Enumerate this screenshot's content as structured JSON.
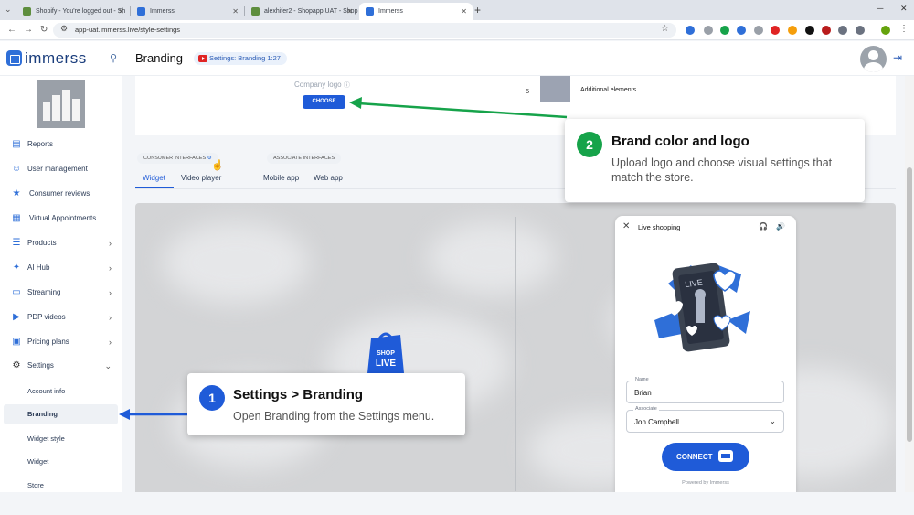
{
  "browser": {
    "tabs": [
      {
        "title": "Shopify - You're logged out - Sh",
        "color": "#5e8e3e"
      },
      {
        "title": "Immerss",
        "color": "#2f6fd8"
      },
      {
        "title": "alexhifer2 - Shopapp UAT - Shop",
        "color": "#5e8e3e"
      },
      {
        "title": "Immerss",
        "color": "#2f6fd8"
      }
    ],
    "url": "app-uat.immerss.live/style-settings"
  },
  "header": {
    "logo": "immerss",
    "page_title": "Branding",
    "settings_pill": "Settings: Branding 1:27"
  },
  "sidebar": {
    "items": [
      {
        "label": "Reports",
        "icon": "reports-icon",
        "glyph": "▤",
        "chevron": false
      },
      {
        "label": "User management",
        "icon": "users-icon",
        "glyph": "👥",
        "chevron": false
      },
      {
        "label": "Consumer reviews",
        "icon": "star-icon",
        "glyph": "★",
        "chevron": false
      },
      {
        "label": "Virtual Appointments",
        "icon": "calendar-icon",
        "glyph": "▦",
        "chevron": false
      },
      {
        "label": "Products",
        "icon": "list-icon",
        "glyph": "☰",
        "chevron": true
      },
      {
        "label": "AI Hub",
        "icon": "ai-icon",
        "glyph": "✦",
        "chevron": true
      },
      {
        "label": "Streaming",
        "icon": "streaming-icon",
        "glyph": "▭",
        "chevron": true
      },
      {
        "label": "PDP videos",
        "icon": "video-icon",
        "glyph": "▶",
        "chevron": true
      },
      {
        "label": "Pricing plans",
        "icon": "pricing-icon",
        "glyph": "▣",
        "chevron": true
      },
      {
        "label": "Settings",
        "icon": "gear-icon",
        "glyph": "⚙",
        "chevron": true
      }
    ],
    "sub_items": [
      "Account info",
      "Branding",
      "Widget style",
      "Widget",
      "Store"
    ],
    "active_sub": "Branding"
  },
  "content": {
    "company_logo_label": "Company logo",
    "choose_button": "CHOOSE",
    "element_number": "5",
    "element_label": "Additional elements",
    "consumer_group": "CONSUMER INTERFACES",
    "associate_group": "ASSOCIATE INTERFACES",
    "tabs": [
      "Widget",
      "Video player",
      "Mobile app",
      "Web app"
    ],
    "active_tab": "Widget"
  },
  "widget": {
    "title": "Live shopping",
    "name_label": "Name",
    "name_value": "Brian",
    "associate_label": "Associate",
    "associate_value": "Jon Campbell",
    "connect_button": "CONNECT",
    "powered_by": "Powered by Immerss",
    "live_text": "LIVE",
    "bag_text": "SHOP LIVE"
  },
  "callouts": [
    {
      "number": "1",
      "title": "Settings > Branding",
      "description": "Open Branding from the Settings menu.",
      "color": "#1f5bd8"
    },
    {
      "number": "2",
      "title": "Brand color and logo",
      "description": "Upload logo and choose visual settings that match the store.",
      "color": "#16a34a"
    }
  ],
  "colors": {
    "primary": "#1f5bd8",
    "callout_green": "#16a34a",
    "brand_navy": "#1a3d7c"
  }
}
